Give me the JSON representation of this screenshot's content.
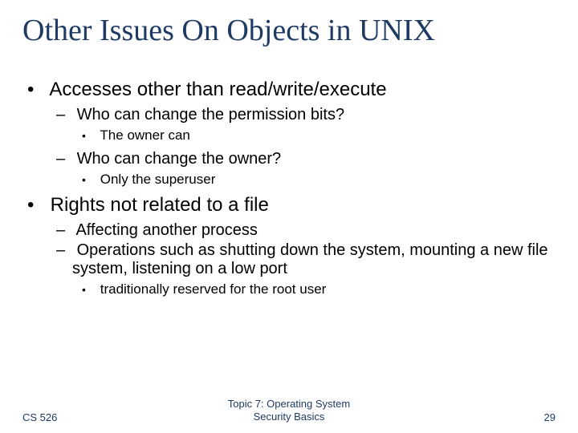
{
  "title": "Other Issues On Objects in UNIX",
  "bullets": {
    "b1": "Accesses other than read/write/execute",
    "b1_1": "Who can change the permission bits?",
    "b1_1_1": "The owner can",
    "b1_2": "Who can change the owner?",
    "b1_2_1": "Only the superuser",
    "b2": "Rights not related to a file",
    "b2_1": "Affecting another process",
    "b2_2": "Operations such as shutting down the system, mounting a new file system, listening on a low port",
    "b2_2_1": "traditionally reserved for the root user"
  },
  "footer": {
    "left": "CS 526",
    "center_line1": "Topic 7: Operating System",
    "center_line2": "Security Basics",
    "right": "29"
  }
}
